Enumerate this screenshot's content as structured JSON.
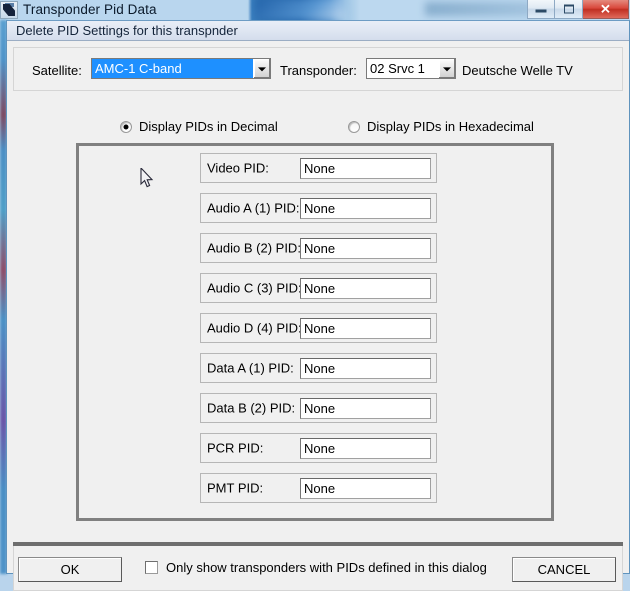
{
  "window": {
    "title": "Transponder Pid Data",
    "icon": "app-icon",
    "controls": {
      "minimize_label": "",
      "maximize_label": "",
      "close_label": "✕"
    }
  },
  "dialog": {
    "header": "Delete PID Settings for this transpnder"
  },
  "selector": {
    "satellite_label": "Satellite:",
    "satellite_value": "AMC-1  C-band",
    "transponder_label": "Transponder:",
    "transponder_value": "02 Srvc 1",
    "channel_name": "Deutsche Welle TV"
  },
  "display_mode": {
    "decimal_label": "Display PIDs in Decimal",
    "decimal_selected": true,
    "hex_label": "Display PIDs in Hexadecimal",
    "hex_selected": false
  },
  "pid_rows": [
    {
      "label": "Video PID:",
      "value": "None"
    },
    {
      "label": "Audio A (1) PID:",
      "value": "None"
    },
    {
      "label": "Audio B (2) PID:",
      "value": "None"
    },
    {
      "label": "Audio C (3) PID:",
      "value": "None"
    },
    {
      "label": "Audio D (4) PID:",
      "value": "None"
    },
    {
      "label": "Data A (1) PID:",
      "value": "None"
    },
    {
      "label": "Data B (2) PID:",
      "value": "None"
    },
    {
      "label": "PCR PID:",
      "value": "None"
    },
    {
      "label": "PMT PID:",
      "value": "None"
    }
  ],
  "footer": {
    "ok_label": "OK",
    "cancel_label": "CANCEL",
    "only_show_label": "Only show transponders with PIDs defined in this dialog",
    "only_show_checked": false
  },
  "colors": {
    "selection_blue": "#1e90ff",
    "dialog_face": "#f0f0f0",
    "group_border": "#808080",
    "close_red": "#c02f22"
  }
}
